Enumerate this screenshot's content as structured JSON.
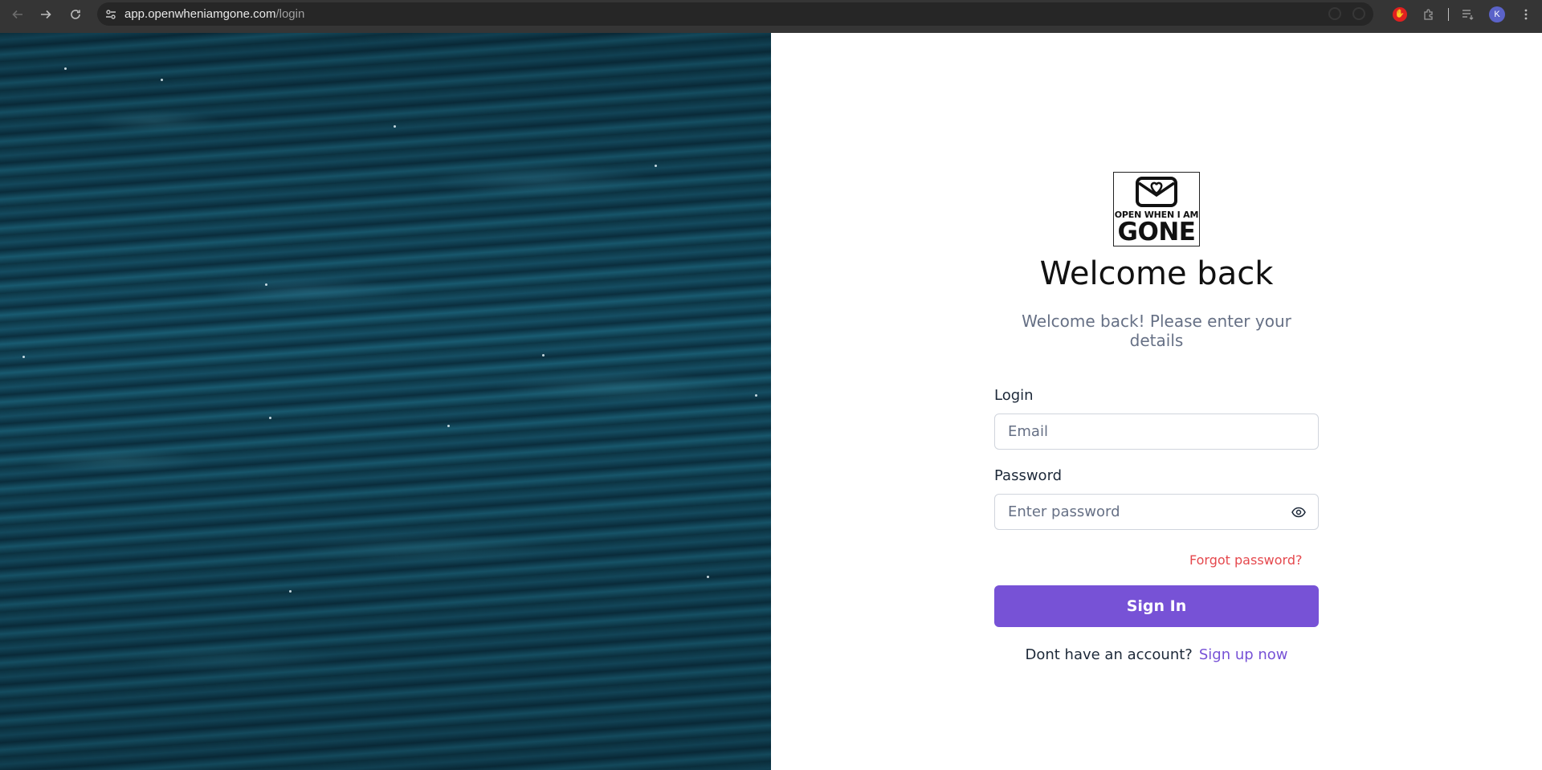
{
  "browser": {
    "url_domain": "app.openwheniamgone.com",
    "url_path": "/login",
    "avatar_letter": "K"
  },
  "logo": {
    "line1": "OPEN WHEN I AM",
    "line2": "GONE"
  },
  "login_form": {
    "title": "Welcome back",
    "subtitle": "Welcome back! Please enter your details",
    "login_label": "Login",
    "email_placeholder": "Email",
    "password_label": "Password",
    "password_placeholder": "Enter password",
    "forgot_password": "Forgot password?",
    "sign_in_button": "Sign In",
    "no_account_text": "Dont have an account?",
    "sign_up_link": "Sign up now"
  },
  "colors": {
    "primary": "#7752d6",
    "forgot_link": "#e5484d",
    "muted_text": "#667085",
    "hero_water": "#103e50"
  },
  "icons": {
    "back": "arrow-left-icon",
    "forward": "arrow-right-icon",
    "reload": "reload-icon",
    "site_info": "tune-icon",
    "password_toggle": "eye-icon",
    "logo": "envelope-heart-icon"
  }
}
